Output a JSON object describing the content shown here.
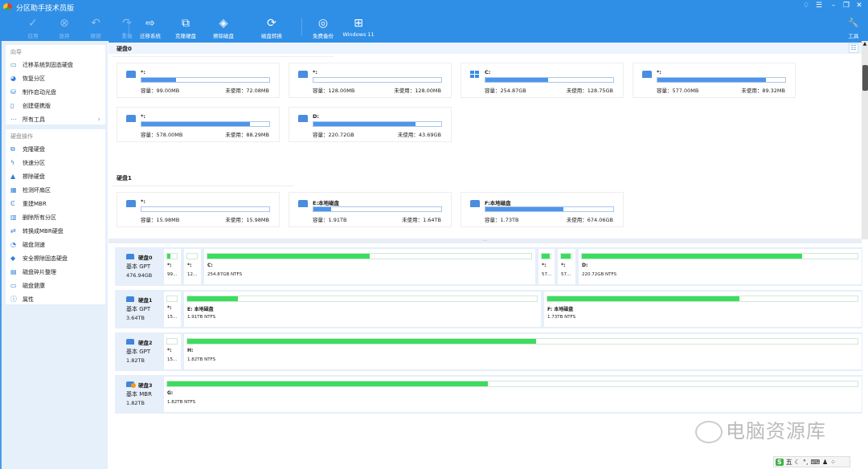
{
  "app": {
    "title": "分区助手技术员版",
    "accent": "#2f8fe6",
    "partition_fill": "#3ddc5f",
    "usage_fill": "#4e95ea"
  },
  "toolbar": [
    {
      "label": "应用",
      "icon": "check-icon",
      "disabled": true
    },
    {
      "label": "放弃",
      "icon": "discard-icon",
      "disabled": true
    },
    {
      "label": "撤销",
      "icon": "undo-icon",
      "disabled": true
    },
    {
      "label": "重做",
      "icon": "redo-icon",
      "disabled": true
    },
    {
      "label": "迁移系统",
      "icon": "migrate-os-icon",
      "disabled": false
    },
    {
      "label": "克隆硬盘",
      "icon": "clone-disk-icon",
      "disabled": false
    },
    {
      "label": "擦除磁盘",
      "icon": "wipe-disk-icon",
      "disabled": false
    },
    {
      "label": "磁盘转换",
      "icon": "convert-disk-icon",
      "disabled": false
    },
    {
      "label": "免费备份",
      "icon": "backup-icon",
      "disabled": false
    },
    {
      "label": "Windows 11",
      "icon": "windows11-icon",
      "disabled": false
    }
  ],
  "tools_label": "工具",
  "sidebar": {
    "wizard_title": "向导",
    "wizard": [
      {
        "label": "迁移系统到固态硬盘",
        "icon": "migrate-ssd-icon"
      },
      {
        "label": "恢复分区",
        "icon": "recover-partition-icon"
      },
      {
        "label": "制作启动光盘",
        "icon": "bootable-media-icon"
      },
      {
        "label": "创建便携版",
        "icon": "portable-icon"
      },
      {
        "label": "所有工具",
        "icon": "more-icon"
      }
    ],
    "ops_title": "硬盘操作",
    "ops": [
      {
        "label": "克隆硬盘",
        "icon": "clone-icon"
      },
      {
        "label": "快速分区",
        "icon": "lightning-icon"
      },
      {
        "label": "擦除硬盘",
        "icon": "eraser-icon"
      },
      {
        "label": "检测坏扇区",
        "icon": "bad-sector-icon"
      },
      {
        "label": "重建MBR",
        "icon": "rebuild-mbr-icon"
      },
      {
        "label": "删除所有分区",
        "icon": "trash-icon"
      },
      {
        "label": "转换成MBR硬盘",
        "icon": "convert-icon"
      },
      {
        "label": "磁盘测速",
        "icon": "speedometer-icon"
      },
      {
        "label": "安全擦除固态硬盘",
        "icon": "secure-erase-icon"
      },
      {
        "label": "磁盘碎片整理",
        "icon": "defrag-icon"
      },
      {
        "label": "磁盘健康",
        "icon": "health-icon"
      },
      {
        "label": "属性",
        "icon": "info-icon"
      }
    ]
  },
  "cards": {
    "cap_prefix": "容量：",
    "free_prefix": "未使用：",
    "disk0_title": "硬盘0",
    "disk1_title": "硬盘1",
    "disk0": [
      {
        "name": "*:",
        "cap": "99.00MB",
        "free": "72.08MB",
        "used": 0.27,
        "icon": "disk-icon"
      },
      {
        "name": "*:",
        "cap": "128.00MB",
        "free": "128.00MB",
        "used": 0,
        "icon": "disk-icon"
      },
      {
        "name": "C:",
        "cap": "254.87GB",
        "free": "128.75GB",
        "used": 0.49,
        "icon": "windows-icon"
      },
      {
        "name": "*:",
        "cap": "577.00MB",
        "free": "89.32MB",
        "used": 0.85,
        "icon": "disk-icon"
      },
      {
        "name": "*:",
        "cap": "578.00MB",
        "free": "88.29MB",
        "used": 0.85,
        "icon": "disk-icon"
      },
      {
        "name": "D:",
        "cap": "220.72GB",
        "free": "43.69GB",
        "used": 0.8,
        "icon": "disk-icon"
      }
    ],
    "disk1": [
      {
        "name": "*:",
        "cap": "15.98MB",
        "free": "15.98MB",
        "used": 0,
        "icon": "disk-icon"
      },
      {
        "name": "E:本地磁盘",
        "cap": "1.91TB",
        "free": "1.64TB",
        "used": 0.14,
        "icon": "disk-icon"
      },
      {
        "name": "F:本地磁盘",
        "cap": "1.73TB",
        "free": "674.06GB",
        "used": 0.61,
        "icon": "disk-icon"
      }
    ]
  },
  "disks": [
    {
      "name": "硬盘0",
      "type": "基本 GPT",
      "size": "476.94GB",
      "warn": false,
      "parts": [
        {
          "name": "*:",
          "info": "99...",
          "used": 0.3
        },
        {
          "name": "*:",
          "info": "12...",
          "used": 0
        },
        {
          "name": "C:",
          "info": "254.87GB NTFS",
          "used": 0.5
        },
        {
          "name": "*:",
          "info": "57...",
          "used": 0.9
        },
        {
          "name": "*:",
          "info": "57...",
          "used": 0.9
        },
        {
          "name": "D:",
          "info": "220.72GB NTFS",
          "used": 0.8
        }
      ]
    },
    {
      "name": "硬盘1",
      "type": "基本 GPT",
      "size": "3.64TB",
      "warn": false,
      "parts": [
        {
          "name": "*:",
          "info": "15...",
          "used": 0
        },
        {
          "name": "E: 本地磁盘",
          "info": "1.91TB NTFS",
          "used": 0.145
        },
        {
          "name": "F: 本地磁盘",
          "info": "1.73TB NTFS",
          "used": 0.62
        }
      ]
    },
    {
      "name": "硬盘2",
      "type": "基本 GPT",
      "size": "1.82TB",
      "warn": false,
      "parts": [
        {
          "name": "*:",
          "info": "15...",
          "used": 0
        },
        {
          "name": "H:",
          "info": "1.82TB NTFS",
          "used": 0.52
        }
      ]
    },
    {
      "name": "硬盘3",
      "type": "基本 MBR",
      "size": "1.82TB",
      "warn": true,
      "parts": [
        {
          "name": "G:",
          "info": "1.82TB NTFS",
          "used": 0.465
        }
      ]
    }
  ],
  "watermark": "电脑资源库",
  "ime": {
    "label": "五"
  }
}
